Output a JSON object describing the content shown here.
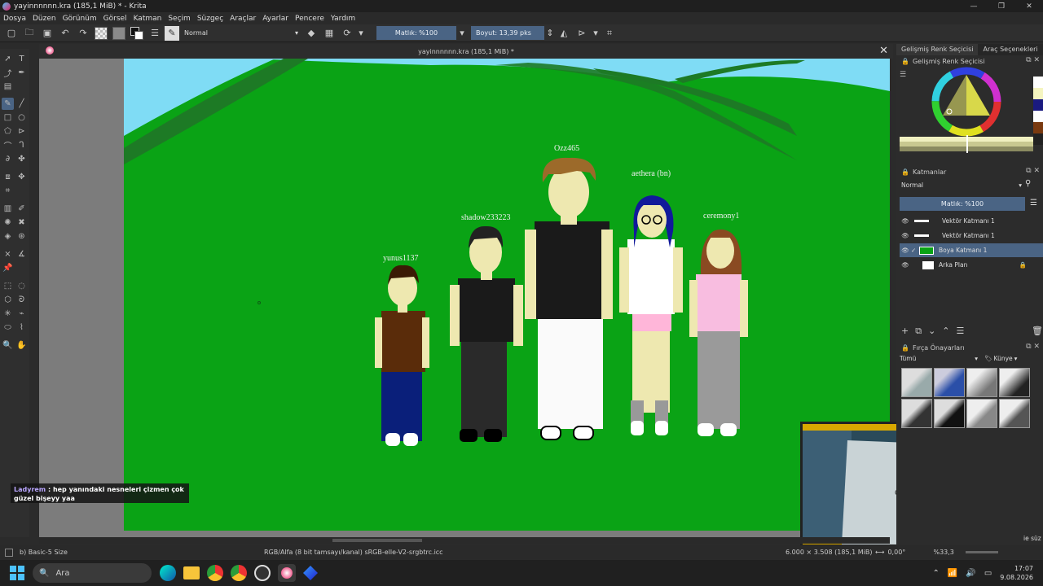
{
  "window": {
    "title": "yayinnnnnn.kra (185,1 MiB) * - Krita",
    "controls": [
      "—",
      "❐",
      "✕"
    ]
  },
  "menu": [
    "Dosya",
    "Düzen",
    "Görünüm",
    "Görsel",
    "Katman",
    "Seçim",
    "Süzgeç",
    "Araçlar",
    "Ayarlar",
    "Pencere",
    "Yardım"
  ],
  "toolbar": {
    "blend_mode": "Normal",
    "opacity": "Matlık: %100",
    "size": "Boyut: 13,39 pks"
  },
  "document": {
    "tab_title": "yayinnnnnn.kra (185,1 MiB) *",
    "close": "✕"
  },
  "drawing": {
    "labels": [
      "yunus1137",
      "shadow233223",
      "Ozz465",
      "aethera (bn)",
      "ceremony1"
    ]
  },
  "chat": {
    "username": "Ladyrem",
    "message": ": hep yanındaki nesneleri çizmen çok güzel bişeyy yaa"
  },
  "right_panel": {
    "tabs": [
      "Gelişmiş Renk Seçicisi",
      "Araç Seçenekleri"
    ],
    "color_dock_title": "Gelişmiş Renk Seçicisi",
    "layers_dock_title": "Katmanlar",
    "layers_blend": "Normal",
    "layers_opacity": "Matlık: %100",
    "layers": [
      {
        "name": "Vektör Katmanı 1",
        "selected": false
      },
      {
        "name": "Vektör Katmanı 1",
        "selected": false
      },
      {
        "name": "Boya Katmanı 1",
        "selected": true
      },
      {
        "name": "Arka Plan",
        "selected": false
      }
    ],
    "brush_dock_title": "Fırça Önayarları",
    "brush_filter": "Tümü",
    "brush_tag": "Künye",
    "brush_hint": "ie süz"
  },
  "status": {
    "brush": "b) Basic-5 Size",
    "color_space": "RGB/Alfa (8 bit tamsayı/kanal)  sRGB-elle-V2-srgbtrc.icc",
    "dimensions": "6.000 × 3.508 (185,1 MiB)",
    "rotation": "0,00°",
    "zoom": "%33,3"
  },
  "taskbar": {
    "search_placeholder": "Ara",
    "time": "17:07",
    "date": "9.08.2026"
  },
  "colors": {
    "grass": "#0aa315",
    "hill_dark": "#1d7a25",
    "sky": "#7fdcf5",
    "accent": "#4a6484"
  }
}
